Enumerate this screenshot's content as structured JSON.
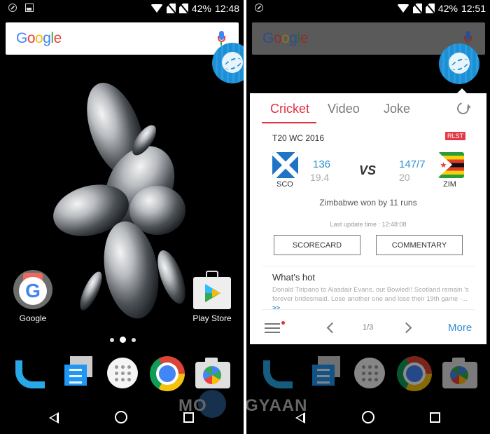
{
  "left_screen": {
    "status_bar": {
      "battery": "42%",
      "time": "12:48"
    },
    "search": {
      "logo": [
        "G",
        "o",
        "o",
        "g",
        "l",
        "e"
      ]
    },
    "home_apps": [
      {
        "label": "Google"
      },
      {
        "label": "Play Store"
      }
    ],
    "page_indicator": {
      "pages": 3,
      "active": 2
    },
    "dock": [
      "Phone",
      "Messenger",
      "App Drawer",
      "Chrome",
      "Camera"
    ]
  },
  "right_screen": {
    "status_bar": {
      "battery": "42%",
      "time": "12:51"
    },
    "search": {
      "logo": [
        "G",
        "o",
        "o",
        "g",
        "l",
        "e"
      ]
    },
    "panel": {
      "tabs": [
        {
          "label": "Cricket",
          "active": true
        },
        {
          "label": "Video",
          "active": false
        },
        {
          "label": "Joke",
          "active": false
        }
      ],
      "series": "T20 WC 2016",
      "badge": "RLST",
      "team1": {
        "code": "SCO",
        "score": "136",
        "overs": "19.4"
      },
      "vs": "VS",
      "team2": {
        "code": "ZIM",
        "score": "147/7",
        "overs": "20"
      },
      "result": "Zimbabwe won by 11 runs",
      "last_update": "Last update time : 12:48:08",
      "buttons": {
        "scorecard": "SCORECARD",
        "commentary": "COMMENTARY"
      },
      "whats_hot": {
        "title": "What's hot",
        "text": "Donald Tiripano to Alasdair Evans, out Bowled!! Scotland remain 's forever bridesmaid. Lose another one and lose their 19th game -... ",
        "more": ">>"
      },
      "footer": {
        "page": "1/3",
        "more": "More"
      }
    }
  },
  "watermark": {
    "left": "MO",
    "mid": "BIGYAAN",
    "right": "GYAAN"
  },
  "colors": {
    "accent_red": "#e0313f",
    "accent_blue": "#2d8fd1",
    "bubble_blue": "#1e8fd4"
  }
}
